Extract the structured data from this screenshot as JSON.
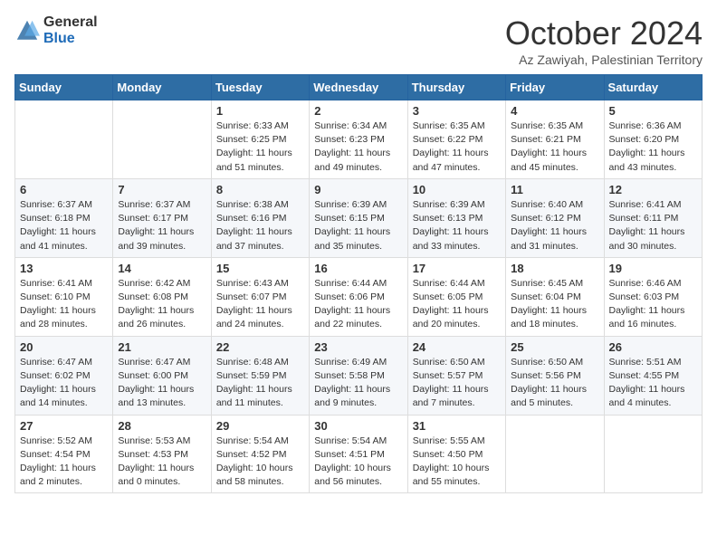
{
  "logo": {
    "general": "General",
    "blue": "Blue"
  },
  "header": {
    "month": "October 2024",
    "location": "Az Zawiyah, Palestinian Territory"
  },
  "weekdays": [
    "Sunday",
    "Monday",
    "Tuesday",
    "Wednesday",
    "Thursday",
    "Friday",
    "Saturday"
  ],
  "weeks": [
    [
      {
        "day": "",
        "info": ""
      },
      {
        "day": "",
        "info": ""
      },
      {
        "day": "1",
        "info": "Sunrise: 6:33 AM\nSunset: 6:25 PM\nDaylight: 11 hours and 51 minutes."
      },
      {
        "day": "2",
        "info": "Sunrise: 6:34 AM\nSunset: 6:23 PM\nDaylight: 11 hours and 49 minutes."
      },
      {
        "day": "3",
        "info": "Sunrise: 6:35 AM\nSunset: 6:22 PM\nDaylight: 11 hours and 47 minutes."
      },
      {
        "day": "4",
        "info": "Sunrise: 6:35 AM\nSunset: 6:21 PM\nDaylight: 11 hours and 45 minutes."
      },
      {
        "day": "5",
        "info": "Sunrise: 6:36 AM\nSunset: 6:20 PM\nDaylight: 11 hours and 43 minutes."
      }
    ],
    [
      {
        "day": "6",
        "info": "Sunrise: 6:37 AM\nSunset: 6:18 PM\nDaylight: 11 hours and 41 minutes."
      },
      {
        "day": "7",
        "info": "Sunrise: 6:37 AM\nSunset: 6:17 PM\nDaylight: 11 hours and 39 minutes."
      },
      {
        "day": "8",
        "info": "Sunrise: 6:38 AM\nSunset: 6:16 PM\nDaylight: 11 hours and 37 minutes."
      },
      {
        "day": "9",
        "info": "Sunrise: 6:39 AM\nSunset: 6:15 PM\nDaylight: 11 hours and 35 minutes."
      },
      {
        "day": "10",
        "info": "Sunrise: 6:39 AM\nSunset: 6:13 PM\nDaylight: 11 hours and 33 minutes."
      },
      {
        "day": "11",
        "info": "Sunrise: 6:40 AM\nSunset: 6:12 PM\nDaylight: 11 hours and 31 minutes."
      },
      {
        "day": "12",
        "info": "Sunrise: 6:41 AM\nSunset: 6:11 PM\nDaylight: 11 hours and 30 minutes."
      }
    ],
    [
      {
        "day": "13",
        "info": "Sunrise: 6:41 AM\nSunset: 6:10 PM\nDaylight: 11 hours and 28 minutes."
      },
      {
        "day": "14",
        "info": "Sunrise: 6:42 AM\nSunset: 6:08 PM\nDaylight: 11 hours and 26 minutes."
      },
      {
        "day": "15",
        "info": "Sunrise: 6:43 AM\nSunset: 6:07 PM\nDaylight: 11 hours and 24 minutes."
      },
      {
        "day": "16",
        "info": "Sunrise: 6:44 AM\nSunset: 6:06 PM\nDaylight: 11 hours and 22 minutes."
      },
      {
        "day": "17",
        "info": "Sunrise: 6:44 AM\nSunset: 6:05 PM\nDaylight: 11 hours and 20 minutes."
      },
      {
        "day": "18",
        "info": "Sunrise: 6:45 AM\nSunset: 6:04 PM\nDaylight: 11 hours and 18 minutes."
      },
      {
        "day": "19",
        "info": "Sunrise: 6:46 AM\nSunset: 6:03 PM\nDaylight: 11 hours and 16 minutes."
      }
    ],
    [
      {
        "day": "20",
        "info": "Sunrise: 6:47 AM\nSunset: 6:02 PM\nDaylight: 11 hours and 14 minutes."
      },
      {
        "day": "21",
        "info": "Sunrise: 6:47 AM\nSunset: 6:00 PM\nDaylight: 11 hours and 13 minutes."
      },
      {
        "day": "22",
        "info": "Sunrise: 6:48 AM\nSunset: 5:59 PM\nDaylight: 11 hours and 11 minutes."
      },
      {
        "day": "23",
        "info": "Sunrise: 6:49 AM\nSunset: 5:58 PM\nDaylight: 11 hours and 9 minutes."
      },
      {
        "day": "24",
        "info": "Sunrise: 6:50 AM\nSunset: 5:57 PM\nDaylight: 11 hours and 7 minutes."
      },
      {
        "day": "25",
        "info": "Sunrise: 6:50 AM\nSunset: 5:56 PM\nDaylight: 11 hours and 5 minutes."
      },
      {
        "day": "26",
        "info": "Sunrise: 5:51 AM\nSunset: 4:55 PM\nDaylight: 11 hours and 4 minutes."
      }
    ],
    [
      {
        "day": "27",
        "info": "Sunrise: 5:52 AM\nSunset: 4:54 PM\nDaylight: 11 hours and 2 minutes."
      },
      {
        "day": "28",
        "info": "Sunrise: 5:53 AM\nSunset: 4:53 PM\nDaylight: 11 hours and 0 minutes."
      },
      {
        "day": "29",
        "info": "Sunrise: 5:54 AM\nSunset: 4:52 PM\nDaylight: 10 hours and 58 minutes."
      },
      {
        "day": "30",
        "info": "Sunrise: 5:54 AM\nSunset: 4:51 PM\nDaylight: 10 hours and 56 minutes."
      },
      {
        "day": "31",
        "info": "Sunrise: 5:55 AM\nSunset: 4:50 PM\nDaylight: 10 hours and 55 minutes."
      },
      {
        "day": "",
        "info": ""
      },
      {
        "day": "",
        "info": ""
      }
    ]
  ]
}
